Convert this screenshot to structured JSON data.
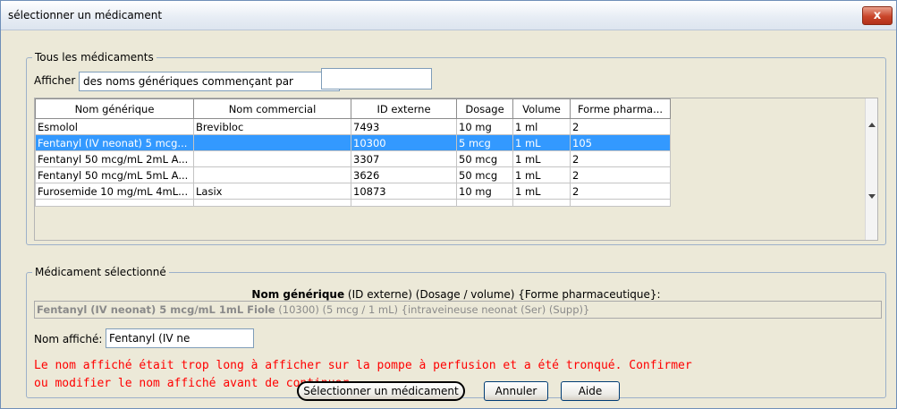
{
  "window": {
    "title": "sélectionner un médicament",
    "close_glyph": "x"
  },
  "all_meds": {
    "legend": "Tous les médicaments",
    "filter_label": "Afficher",
    "filter_mode": "des noms génériques commençant par",
    "filter_value": "",
    "columns": [
      "Nom générique",
      "Nom commercial",
      "ID externe",
      "Dosage",
      "Volume",
      "Forme pharma..."
    ],
    "rows": [
      [
        "Esmolol",
        "Brevibloc",
        "7493",
        "10 mg",
        "1 ml",
        "2"
      ],
      [
        "Fentanyl (IV neonat) 5 mcg...",
        "",
        "10300",
        "5 mcg",
        "1 mL",
        "105"
      ],
      [
        "Fentanyl 50 mcg/mL  2mL A...",
        "",
        "3307",
        "50 mcg",
        "1 mL",
        "2"
      ],
      [
        "Fentanyl 50 mcg/mL  5mL A...",
        "",
        "3626",
        "50 mcg",
        "1 mL",
        "2"
      ],
      [
        "Furosemide 10 mg/mL  4mL...",
        "Lasix",
        "10873",
        "10 mg",
        "1 mL",
        "2"
      ]
    ],
    "selected_row": 1
  },
  "selected_med": {
    "legend": "Médicament sélectionné",
    "desc_bold": "Nom générique",
    "desc_rest": " (ID externe) (Dosage / volume) {Forme pharmaceutique}:",
    "full_name_bold": "Fentanyl (IV neonat) 5 mcg/mL 1mL Fiole",
    "full_name_rest": " (10300) (5 mcg / 1 mL) {intraveineuse neonat (Ser) (Supp)}",
    "display_label": "Nom affiché:",
    "display_value": "Fentanyl (IV ne",
    "warning_line1": "Le nom affiché était trop long à afficher sur la pompe à perfusion et a été tronqué. Confirmer",
    "warning_line2": "ou modifier le nom affiché avant de continuer."
  },
  "buttons": {
    "select": "Sélectionner un médicament",
    "cancel": "Annuler",
    "help": "Aide"
  },
  "colors": {
    "selection": "#3399ff",
    "warning": "#ff0000"
  }
}
